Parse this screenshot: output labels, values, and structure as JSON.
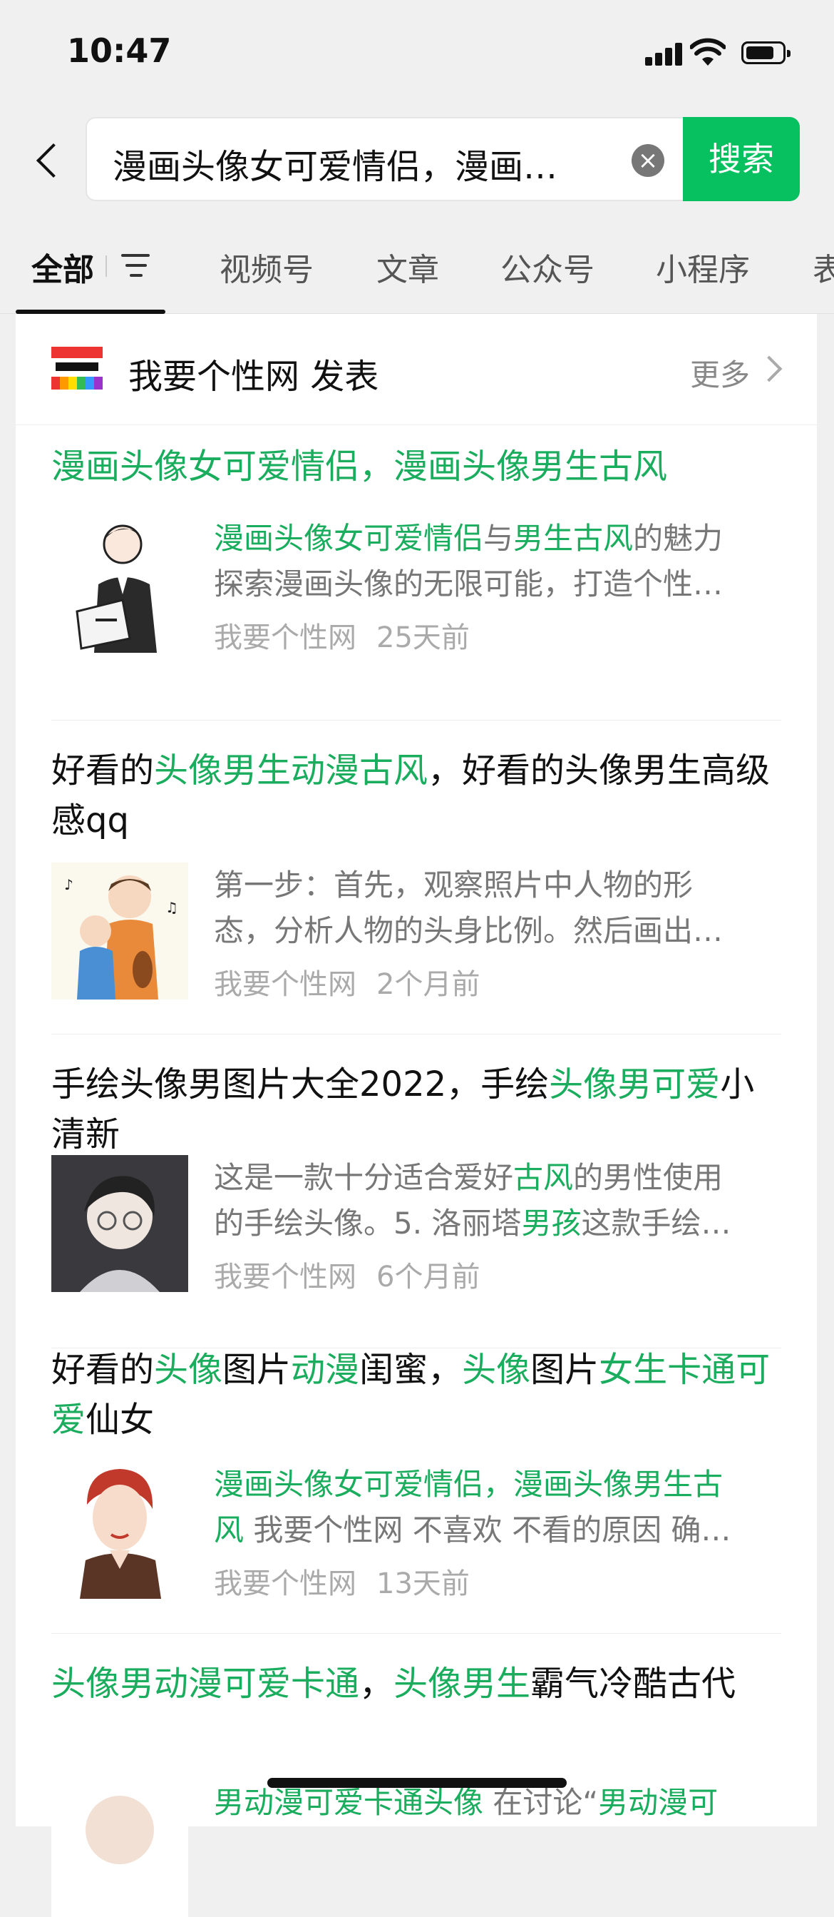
{
  "status_bar": {
    "time": "10:47"
  },
  "search": {
    "query": "漫画头像女可爱情侣，漫画…",
    "button_label": "搜索"
  },
  "tabs": [
    {
      "label": "全部",
      "active": true
    },
    {
      "label": "视频号"
    },
    {
      "label": "文章"
    },
    {
      "label": "公众号"
    },
    {
      "label": "小程序"
    },
    {
      "label": "表"
    }
  ],
  "source": {
    "name": "我要个性网 发表",
    "more_label": "更多"
  },
  "articles": [
    {
      "title_parts": [
        {
          "t": "漫画头像女可爱情侣，漫画头像男生古风",
          "g": true
        }
      ],
      "desc_lines": [
        [
          {
            "t": "漫画头像女可爱情侣",
            "g": true
          },
          {
            "t": "与",
            "g": false
          },
          {
            "t": "男生古风",
            "g": true
          },
          {
            "t": "的魅力",
            "g": false
          }
        ],
        [
          {
            "t": "探索漫画头像的无限可能，打造个性…",
            "g": false
          }
        ]
      ],
      "source": "我要个性网",
      "time": "25天前"
    },
    {
      "title_parts": [
        {
          "t": "好看的",
          "g": false
        },
        {
          "t": "头像男生动漫古风",
          "g": true
        },
        {
          "t": "，好看的头像男生高级感qq",
          "g": false
        }
      ],
      "desc_lines": [
        [
          {
            "t": "第一步：首先，观察照片中人物的形",
            "g": false
          }
        ],
        [
          {
            "t": "态，分析人物的头身比例。然后画出…",
            "g": false
          }
        ]
      ],
      "source": "我要个性网",
      "time": "2个月前"
    },
    {
      "title_parts": [
        {
          "t": "手绘头像男图片大全2022，手绘",
          "g": false
        },
        {
          "t": "头像男可爱",
          "g": true
        },
        {
          "t": "小清新",
          "g": false
        }
      ],
      "desc_lines": [
        [
          {
            "t": "这是一款十分适合爱好",
            "g": false
          },
          {
            "t": "古风",
            "g": true
          },
          {
            "t": "的男性使用",
            "g": false
          }
        ],
        [
          {
            "t": "的手绘头像。5. 洛丽塔",
            "g": false
          },
          {
            "t": "男孩",
            "g": true
          },
          {
            "t": "这款手绘…",
            "g": false
          }
        ]
      ],
      "source": "我要个性网",
      "time": "6个月前"
    },
    {
      "title_parts": [
        {
          "t": "好看的",
          "g": false
        },
        {
          "t": "头像",
          "g": true
        },
        {
          "t": "图片",
          "g": false
        },
        {
          "t": "动漫",
          "g": true
        },
        {
          "t": "闺蜜，",
          "g": false
        },
        {
          "t": "头像",
          "g": true
        },
        {
          "t": "图片",
          "g": false
        },
        {
          "t": "女生卡通可爱",
          "g": true
        },
        {
          "t": "仙女",
          "g": false
        }
      ],
      "desc_lines": [
        [
          {
            "t": "漫画头像女可爱情侣，漫画头像男生古",
            "g": true
          }
        ],
        [
          {
            "t": "风",
            "g": true
          },
          {
            "t": " 我要个性网 不喜欢 不看的原因 确…",
            "g": false
          }
        ]
      ],
      "source": "我要个性网",
      "time": "13天前"
    },
    {
      "title_parts": [
        {
          "t": "头像男动漫可爱卡通",
          "g": true
        },
        {
          "t": "，",
          "g": false
        },
        {
          "t": "头像男生",
          "g": true
        },
        {
          "t": "霸气冷酷古代",
          "g": false
        }
      ],
      "desc_lines": [
        [
          {
            "t": "男动漫可爱卡通头像",
            "g": true
          },
          {
            "t": " 在讨论“",
            "g": false
          },
          {
            "t": "男动漫可",
            "g": true
          }
        ]
      ],
      "source": "",
      "time": ""
    }
  ]
}
